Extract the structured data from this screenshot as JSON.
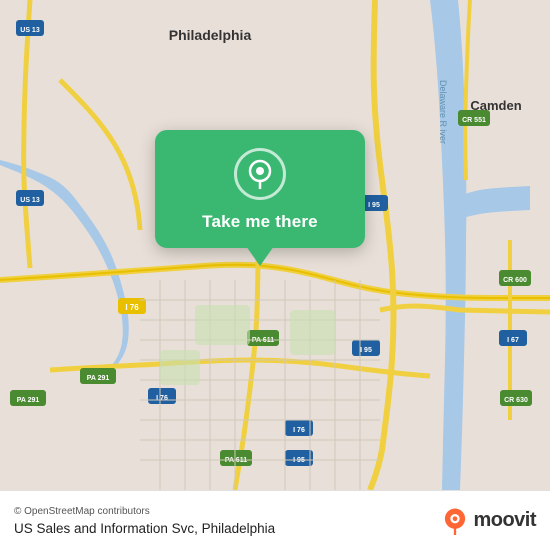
{
  "map": {
    "attribution": "© OpenStreetMap contributors",
    "background_color": "#e8e0d8"
  },
  "popup": {
    "take_me_there_label": "Take me there"
  },
  "bottom_bar": {
    "attribution": "© OpenStreetMap contributors",
    "location_name": "US Sales and Information Svc, Philadelphia"
  },
  "moovit": {
    "logo_text": "moovit"
  },
  "icons": {
    "location_pin": "📍",
    "location_circle": "◎"
  }
}
